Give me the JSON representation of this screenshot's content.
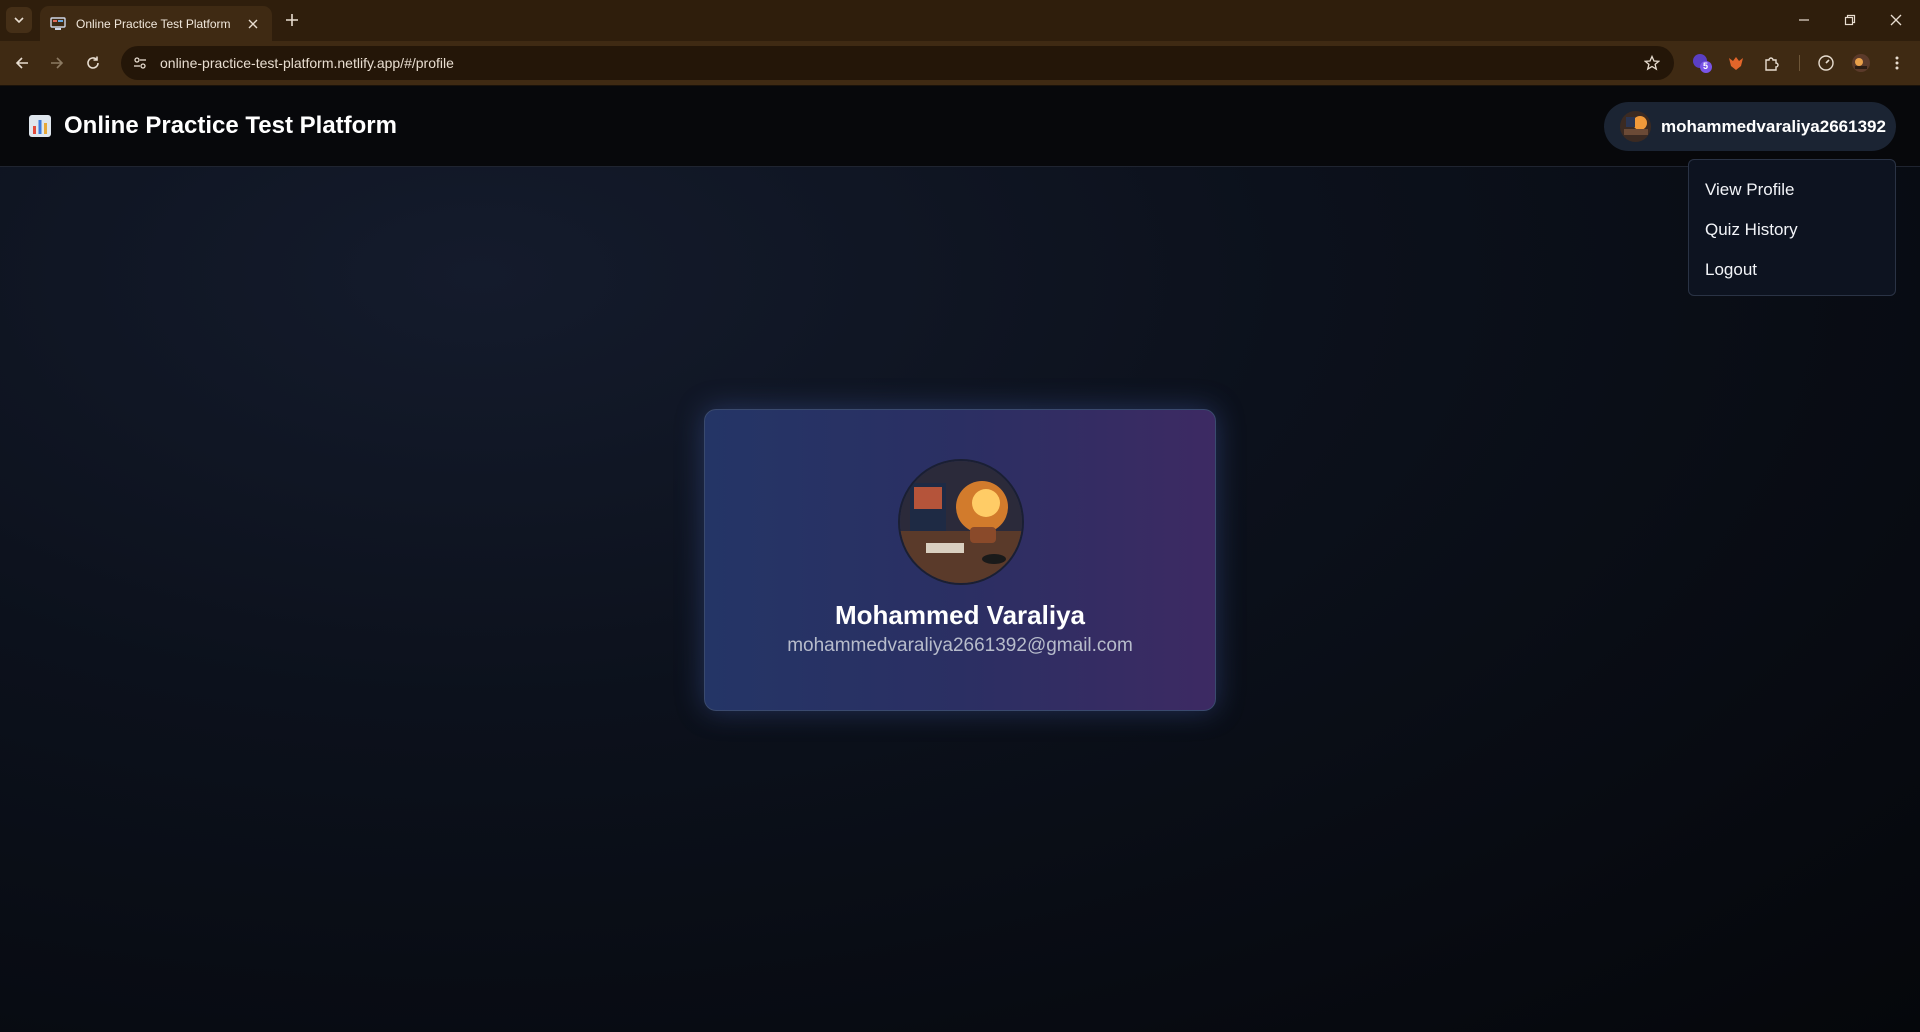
{
  "browser": {
    "tab_title": "Online Practice Test Platform",
    "url": "online-practice-test-platform.netlify.app/#/profile",
    "extension_badge": "5"
  },
  "header": {
    "title": "Online Practice Test Platform",
    "username": "mohammedvaraliya2661392"
  },
  "user_menu": {
    "items": [
      {
        "label": "View Profile"
      },
      {
        "label": "Quiz History"
      },
      {
        "label": "Logout"
      }
    ]
  },
  "profile": {
    "name": "Mohammed Varaliya",
    "email": "mohammedvaraliya2661392@gmail.com"
  },
  "colors": {
    "chrome": "#3f2a13",
    "page_bg": "#0a0c12",
    "card_start": "#243566",
    "card_end": "#3d2a63"
  }
}
